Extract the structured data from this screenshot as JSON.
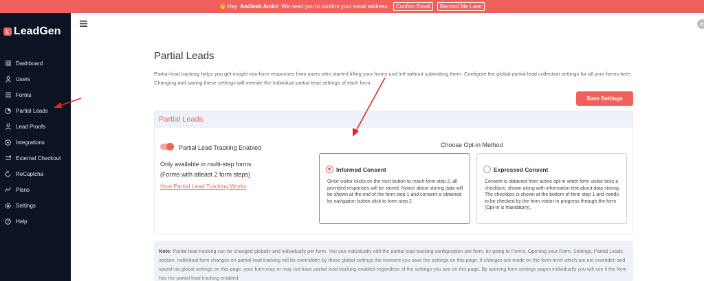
{
  "banner": {
    "prefix": "👋 Hey",
    "name": "Andleeb Amin!",
    "message": "We need you to confirm your email address.",
    "confirm_label": "Confirm Email",
    "remind_label": "Remind Me Later"
  },
  "brand": {
    "badge": "L",
    "name": "LeadGen"
  },
  "sidebar": {
    "items": [
      {
        "label": "Dashboard",
        "icon": "grid-icon"
      },
      {
        "label": "Users",
        "icon": "user-icon"
      },
      {
        "label": "Forms",
        "icon": "list-icon"
      },
      {
        "label": "Partial Leads",
        "icon": "partial-icon"
      },
      {
        "label": "Lead Proofs",
        "icon": "person-icon"
      },
      {
        "label": "Integrations",
        "icon": "plug-icon"
      },
      {
        "label": "External Checkout",
        "icon": "checkout-icon"
      },
      {
        "label": "ReCaptcha",
        "icon": "recaptcha-icon"
      },
      {
        "label": "Plans",
        "icon": "chart-icon"
      },
      {
        "label": "Settings",
        "icon": "gear-icon"
      },
      {
        "label": "Help",
        "icon": "help-icon"
      }
    ]
  },
  "header": {
    "menu_icon": "hamburger-icon",
    "avatar_initial": "e"
  },
  "page": {
    "title": "Partial Leads",
    "description": "Partial lead tracking helps you get insight into form responses from users who started filling your forms and left without submitting them. Configure the global partial lead collection settings for all your forms here. Changing and saving these settings will overide the individual partial lead settings of each form.",
    "save_label": "Save Settings"
  },
  "card": {
    "header": "Partial Leads",
    "toggle_label": "Partial Lead Tracking Enabled",
    "toggle_on": true,
    "only_line1": "Only available in multi-step forms",
    "only_line2": "(Forms with atleast 2 form steps)",
    "link_label": "How Partial Lead Tracking Works",
    "optin_title": "Choose Opt-in Method",
    "options": [
      {
        "title": "Informed Consent",
        "selected": true,
        "description": "Once visitor clicks on the next button to reach form step 2, all provided responses will be stored. Notice about storing data will be shown at the end of the form step 1 and consent is obtained by navigation button click to form step 2."
      },
      {
        "title": "Expressed Consent",
        "selected": false,
        "description": "Consent is obtained from active opt-in when form visitor ticks a checkbox, shown along with information text about data storing. The checkbox is shown at the bottom of form step 1 and needs to be checked by the form visitor to progress through the form (Opt-in is mandatory)."
      }
    ]
  },
  "note": {
    "label": "Note:",
    "text": "Partial lead tracking can be changed globally and individually per form. You can individually edit the partial lead tracking configuration per form, by going to Forms, Opening your Form, Settings, Partial Leads section. Individual form changes on partial lead tracking will be overridden by these global settings the moment you save the settings on this page. If changes are made on the form-level which are not overriden and saved via global settings on this page, your form may or may not have partial lead tracking enabled regardless of the settings you see on this page. By opening form settings pages individually you will see if the form has the partial lead tracking enabled."
  },
  "colors": {
    "accent": "#f0615e",
    "sidebar_bg": "#0c1424",
    "panel_bg": "#eef2f8"
  }
}
